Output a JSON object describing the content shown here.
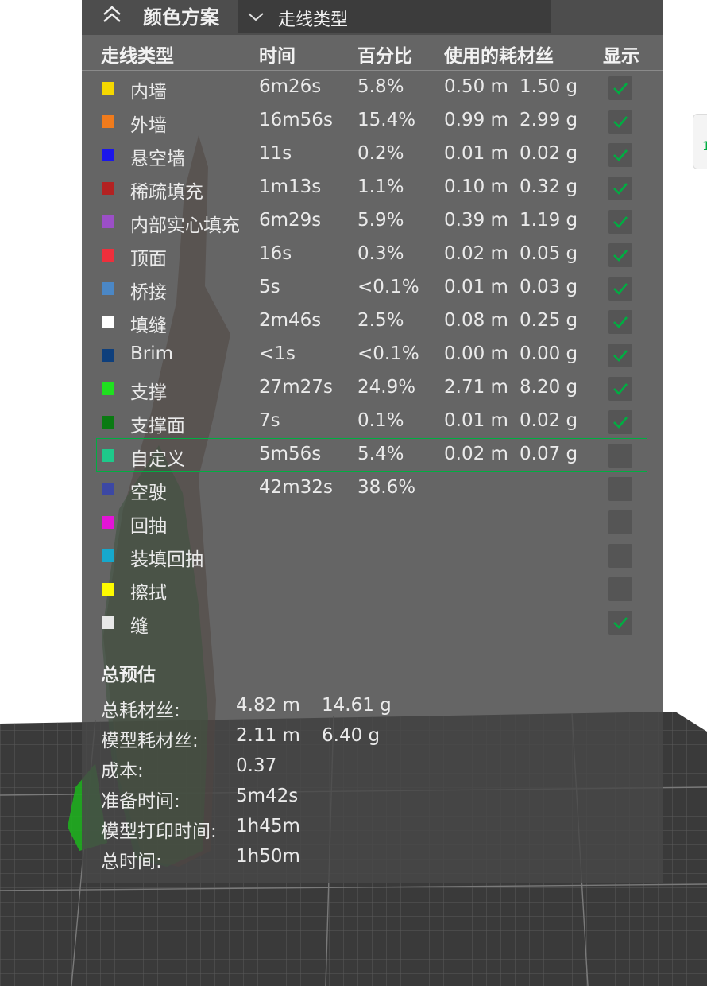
{
  "header": {
    "scheme_label": "颜色方案",
    "dropdown_value": "走线类型"
  },
  "columns": {
    "type": "走线类型",
    "time": "时间",
    "percent": "百分比",
    "filament": "使用的耗材丝",
    "show": "显示"
  },
  "rows": [
    {
      "name": "内墙",
      "color": "#f5d800",
      "time": "6m26s",
      "percent": "5.8%",
      "length": "0.50 m",
      "weight": "1.50 g",
      "shown": true
    },
    {
      "name": "外墙",
      "color": "#f07b1c",
      "time": "16m56s",
      "percent": "15.4%",
      "length": "0.99 m",
      "weight": "2.99 g",
      "shown": true
    },
    {
      "name": "悬空墙",
      "color": "#1b16ea",
      "time": "11s",
      "percent": "0.2%",
      "length": "0.01 m",
      "weight": "0.02 g",
      "shown": true
    },
    {
      "name": "稀疏填充",
      "color": "#b32222",
      "time": "1m13s",
      "percent": "1.1%",
      "length": "0.10 m",
      "weight": "0.32 g",
      "shown": true
    },
    {
      "name": "内部实心填充",
      "color": "#9b4fc7",
      "time": "6m29s",
      "percent": "5.9%",
      "length": "0.39 m",
      "weight": "1.19 g",
      "shown": true
    },
    {
      "name": "顶面",
      "color": "#ee2f3c",
      "time": "16s",
      "percent": "0.3%",
      "length": "0.02 m",
      "weight": "0.05 g",
      "shown": true
    },
    {
      "name": "桥接",
      "color": "#4b87c5",
      "time": "5s",
      "percent": "<0.1%",
      "length": "0.01 m",
      "weight": "0.03 g",
      "shown": true
    },
    {
      "name": "填缝",
      "color": "#ffffff",
      "time": "2m46s",
      "percent": "2.5%",
      "length": "0.08 m",
      "weight": "0.25 g",
      "shown": true
    },
    {
      "name": "Brim",
      "color": "#0e3f7c",
      "time": "<1s",
      "percent": "<0.1%",
      "length": "0.00 m",
      "weight": "0.00 g",
      "shown": true
    },
    {
      "name": "支撑",
      "color": "#1fe01f",
      "time": "27m27s",
      "percent": "24.9%",
      "length": "2.71 m",
      "weight": "8.20 g",
      "shown": true
    },
    {
      "name": "支撑面",
      "color": "#0a7a12",
      "time": "7s",
      "percent": "0.1%",
      "length": "0.01 m",
      "weight": "0.02 g",
      "shown": true
    },
    {
      "name": "自定义",
      "color": "#1ec98a",
      "time": "5m56s",
      "percent": "5.4%",
      "length": "0.02 m",
      "weight": "0.07 g",
      "shown": false,
      "highlighted": true
    },
    {
      "name": "空驶",
      "color": "#3c48a4",
      "time": "42m32s",
      "percent": "38.6%",
      "length": "",
      "weight": "",
      "shown": false
    },
    {
      "name": "回抽",
      "color": "#e414d7",
      "time": "",
      "percent": "",
      "length": "",
      "weight": "",
      "shown": false
    },
    {
      "name": "装填回抽",
      "color": "#16a8cc",
      "time": "",
      "percent": "",
      "length": "",
      "weight": "",
      "shown": false
    },
    {
      "name": "擦拭",
      "color": "#fffb00",
      "time": "",
      "percent": "",
      "length": "",
      "weight": "",
      "shown": false
    },
    {
      "name": "缝",
      "color": "#e8e8e8",
      "time": "",
      "percent": "",
      "length": "",
      "weight": "",
      "shown": true
    }
  ],
  "summary": {
    "title": "总预估",
    "items": [
      {
        "label": "总耗材丝:",
        "v1": "4.82 m",
        "v2": "14.61 g"
      },
      {
        "label": "模型耗材丝:",
        "v1": "2.11 m",
        "v2": "6.40 g"
      },
      {
        "label": "成本:",
        "v1": "0.37",
        "v2": ""
      },
      {
        "label": "准备时间:",
        "v1": "5m42s",
        "v2": ""
      },
      {
        "label": "模型打印时间:",
        "v1": "1h45m",
        "v2": ""
      },
      {
        "label": "总时间:",
        "v1": "1h50m",
        "v2": ""
      }
    ]
  },
  "colors": {
    "accent": "#00ae42",
    "panel_bg": "#484848",
    "checkbox_bg": "#555555"
  },
  "icons": {
    "collapse": "chevron-up-double-icon",
    "dropdown": "chevron-down-icon",
    "check": "check-icon"
  }
}
